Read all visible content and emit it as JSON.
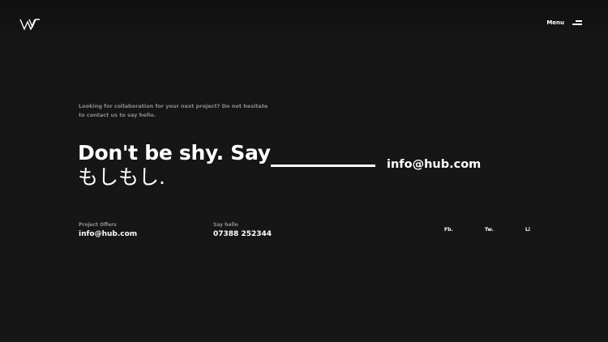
{
  "header": {
    "logo_icon": "w-logo-icon",
    "menu_label": "Menu",
    "menu_icon": "hamburger-icon"
  },
  "contact": {
    "intro": "Looking for collaboration for your next project? Do not hesitate to contact us to say hello.",
    "headline_line1": "Don't be shy. Say",
    "headline_line2": "もしもし.",
    "email": "info@hub.com"
  },
  "footer": {
    "project_offers_label": "Project Offers",
    "project_offers_value": "info@hub.com",
    "say_hello_label": "Say hello",
    "say_hello_value": "07388 252344",
    "social": [
      "Fb.",
      "Tw.",
      "Li"
    ]
  },
  "colors": {
    "background": "#161616",
    "text": "#ffffff",
    "muted": "#8a8a8a"
  }
}
